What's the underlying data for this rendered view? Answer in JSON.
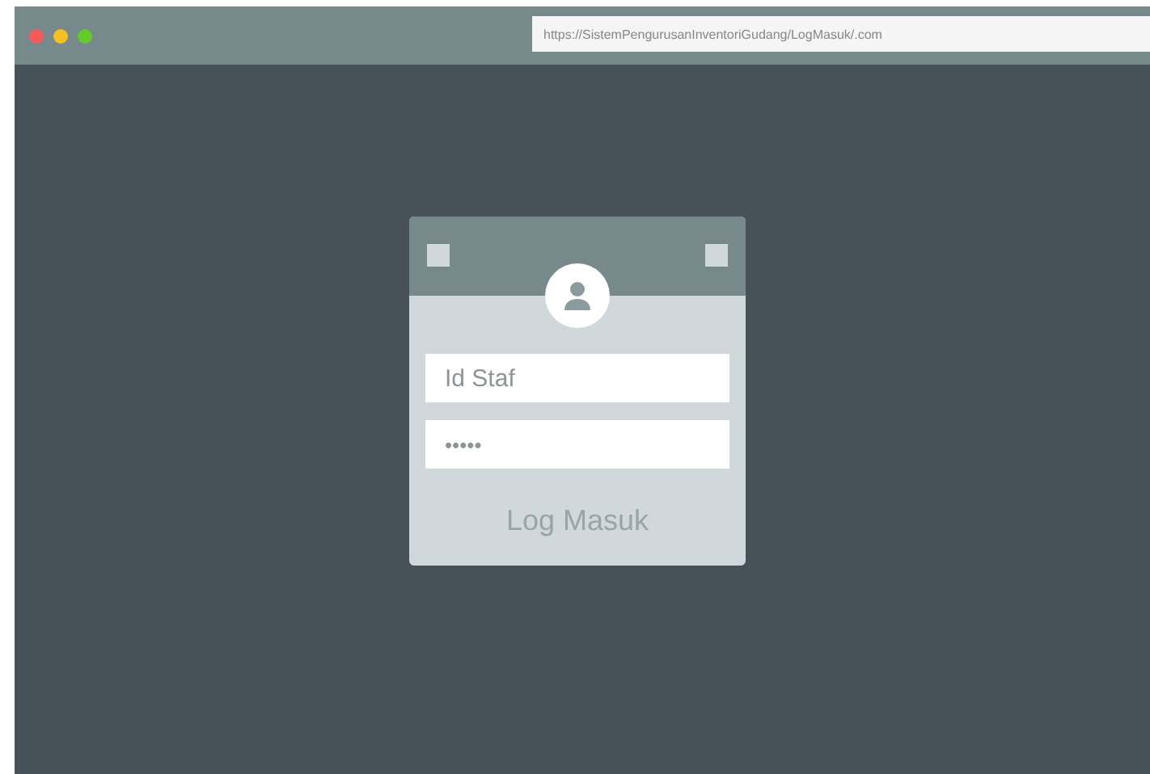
{
  "browser": {
    "url": "https://SistemPengurusanInventoriGudang/LogMasuk/.com"
  },
  "login": {
    "id_field": {
      "placeholder": "Id Staf"
    },
    "password_field": {
      "value": "•••••"
    },
    "button": "Log Masuk"
  }
}
